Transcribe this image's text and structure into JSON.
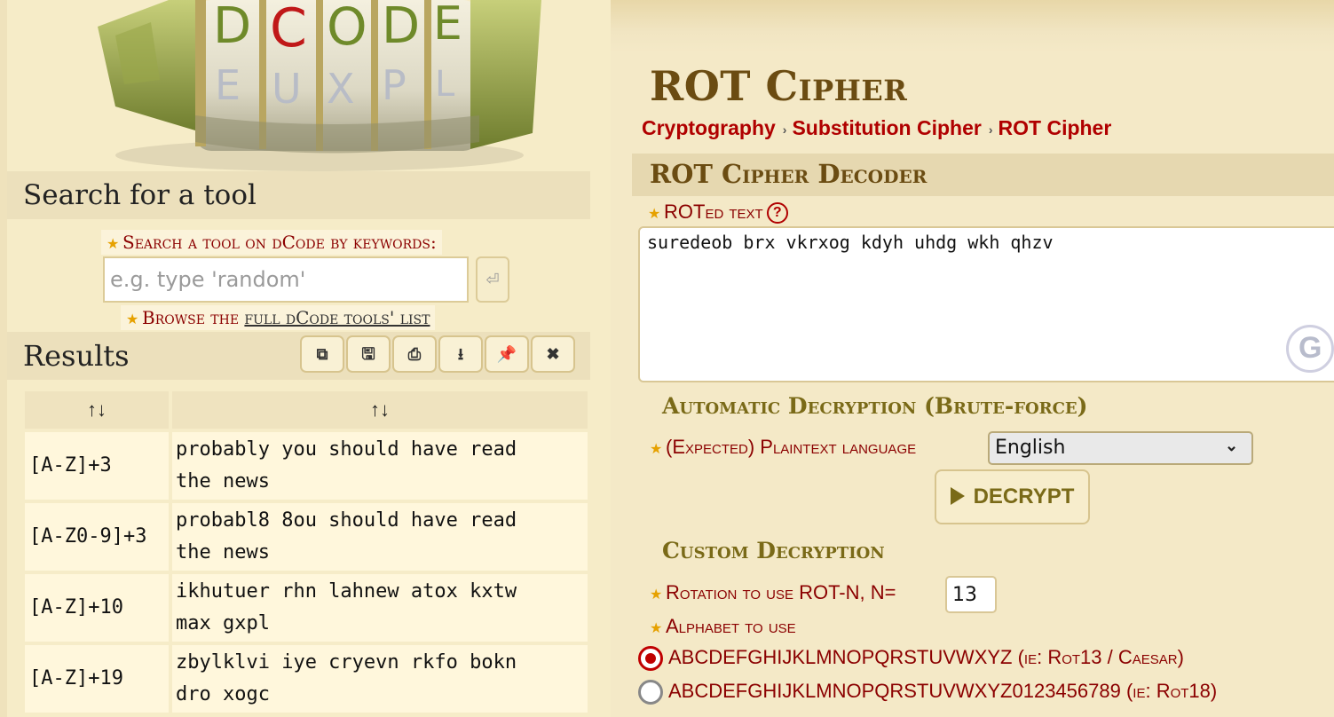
{
  "logo": {
    "letters_top": [
      "D",
      "C",
      "O",
      "D",
      "E"
    ],
    "letters_mid": [
      "E",
      "U",
      "X",
      "P",
      "L"
    ]
  },
  "search": {
    "title": "Search for a tool",
    "label": "Search a tool on dCode by keywords:",
    "placeholder": "e.g. type 'random'",
    "go_icon": "⏎",
    "browse_prefix": "Browse the ",
    "browse_link": "full dCode tools' list"
  },
  "results": {
    "title": "Results",
    "tools": [
      {
        "name": "copy-icon",
        "glyph": "⧉"
      },
      {
        "name": "save-icon",
        "glyph": "🖫"
      },
      {
        "name": "print-icon",
        "glyph": "⎙"
      },
      {
        "name": "download-icon",
        "glyph": "⭳"
      },
      {
        "name": "pin-icon",
        "glyph": "📌"
      },
      {
        "name": "close-icon",
        "glyph": "✖"
      }
    ],
    "headers": [
      "↑↓",
      "↑↓"
    ],
    "rows": [
      {
        "key": "[A-Z]+3",
        "line1": "probably you should have read",
        "line2": "the news"
      },
      {
        "key": "[A-Z0-9]+3",
        "line1": "probabl8 8ou should have read",
        "line2": "the news"
      },
      {
        "key": "[A-Z]+10",
        "line1": "ikhutuer rhn lahnew atox kxtw",
        "line2": "max gxpl"
      },
      {
        "key": "[A-Z]+19",
        "line1": "zbylklvi iye cryevn rkfo bokn",
        "line2": "dro xogc"
      }
    ]
  },
  "page": {
    "title": "ROT Cipher",
    "breadcrumb": [
      "Cryptography",
      "Substitution Cipher",
      "ROT Cipher"
    ],
    "breadcrumb_sep": "›"
  },
  "decoder": {
    "title": "ROT Cipher Decoder",
    "roted_label": "ROTed text",
    "help_icon": "?",
    "ciphertext": "suredeob brx vkrxog kdyh uhdg wkh qhzv",
    "auto_title": "Automatic Decryption (Brute-force)",
    "lang_label": "(Expected) Plaintext language",
    "lang_value": "English",
    "decrypt_label": "DECRYPT",
    "custom_title": "Custom Decryption",
    "rot_label": "Rotation to use ROT-N, N=",
    "rot_value": "13",
    "alphabet_label": "Alphabet to use",
    "alphabets": [
      {
        "alphabet": "ABCDEFGHIJKLMNOPQRSTUVWXYZ",
        "note": "(ie: Rot13 / Caesar)",
        "checked": true
      },
      {
        "alphabet": "ABCDEFGHIJKLMNOPQRSTUVWXYZ0123456789",
        "note": "(ie: Rot18)",
        "checked": false
      }
    ]
  },
  "colors": {
    "accent": "#8b0000",
    "link": "#b00000",
    "title": "#6b4c12",
    "section": "#7a6a18",
    "panel": "#ece0bc"
  }
}
